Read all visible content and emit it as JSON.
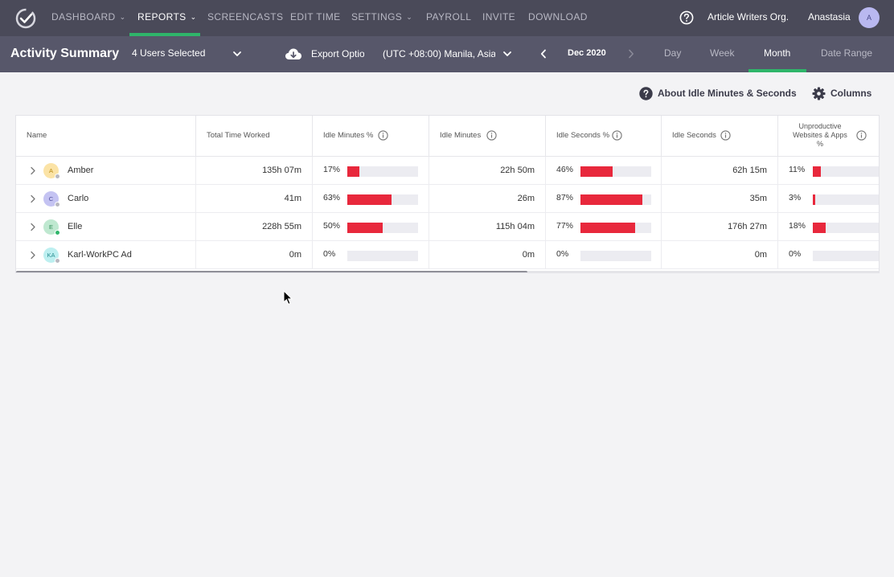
{
  "nav": {
    "items": [
      {
        "label": "DASHBOARD",
        "dropdown": true
      },
      {
        "label": "REPORTS",
        "dropdown": true,
        "active": true
      },
      {
        "label": "SCREENCASTS"
      },
      {
        "label": "EDIT TIME"
      },
      {
        "label": "SETTINGS",
        "dropdown": true
      },
      {
        "label": "PAYROLL"
      },
      {
        "label": "INVITE"
      },
      {
        "label": "DOWNLOAD"
      }
    ],
    "org": "Article Writers Org.",
    "user": "Anastasia",
    "user_initial": "A"
  },
  "subnav": {
    "title": "Activity Summary",
    "users_selected": "4 Users Selected",
    "export_label": "Export Options",
    "timezone": "(UTC +08:00) Manila, Asia",
    "date": "Dec 2020",
    "ranges": [
      "Day",
      "Week",
      "Month",
      "Date Range"
    ],
    "active_range": "Month"
  },
  "toolbar": {
    "about": "About Idle Minutes & Seconds",
    "columns": "Columns"
  },
  "table": {
    "headers": {
      "name": "Name",
      "total": "Total Time Worked",
      "idle_min_pct": "Idle Minutes %",
      "idle_min": "Idle Minutes",
      "idle_sec_pct": "Idle Seconds %",
      "idle_sec": "Idle Seconds",
      "unprod_line1": "Unproductive",
      "unprod_line2": "Websites & Apps",
      "unprod_line3": "%"
    },
    "rows": [
      {
        "initials": "A",
        "name": "Amber",
        "total": "135h 07m",
        "idle_min_pct": "17%",
        "idle_min_frac": 0.17,
        "idle_min": "22h 50m",
        "idle_sec_pct": "46%",
        "idle_sec_frac": 0.46,
        "idle_sec": "62h 15m",
        "unprod_pct": "11%",
        "unprod_frac": 0.11,
        "avatar_bg": "#fbe3a6",
        "avatar_fg": "#b88a14",
        "status": "#b8b8c0"
      },
      {
        "initials": "C",
        "name": "Carlo",
        "total": "41m",
        "idle_min_pct": "63%",
        "idle_min_frac": 0.63,
        "idle_min": "26m",
        "idle_sec_pct": "87%",
        "idle_sec_frac": 0.87,
        "idle_sec": "35m",
        "unprod_pct": "3%",
        "unprod_frac": 0.03,
        "avatar_bg": "#c4c3f2",
        "avatar_fg": "#4d4c9a",
        "status": "#b8b8c0"
      },
      {
        "initials": "E",
        "name": "Elle",
        "total": "228h 55m",
        "idle_min_pct": "50%",
        "idle_min_frac": 0.5,
        "idle_min": "115h 04m",
        "idle_sec_pct": "77%",
        "idle_sec_frac": 0.77,
        "idle_sec": "176h 27m",
        "unprod_pct": "18%",
        "unprod_frac": 0.18,
        "avatar_bg": "#bfe8d0",
        "avatar_fg": "#2c8a55",
        "status": "#2fb56a"
      },
      {
        "initials": "KA",
        "name": "Karl-WorkPC Ad",
        "total": "0m",
        "idle_min_pct": "0%",
        "idle_min_frac": 0,
        "idle_min": "0m",
        "idle_sec_pct": "0%",
        "idle_sec_frac": 0,
        "idle_sec": "0m",
        "unprod_pct": "0%",
        "unprod_frac": 0,
        "avatar_bg": "#bdeff0",
        "avatar_fg": "#2a8f92",
        "status": "#b8b8c0"
      }
    ]
  },
  "colors": {
    "nav_bg": "#4a4a59",
    "subnav_bg": "#57576a",
    "accent_green": "#2fb56a",
    "bar_red": "#e8283c"
  }
}
